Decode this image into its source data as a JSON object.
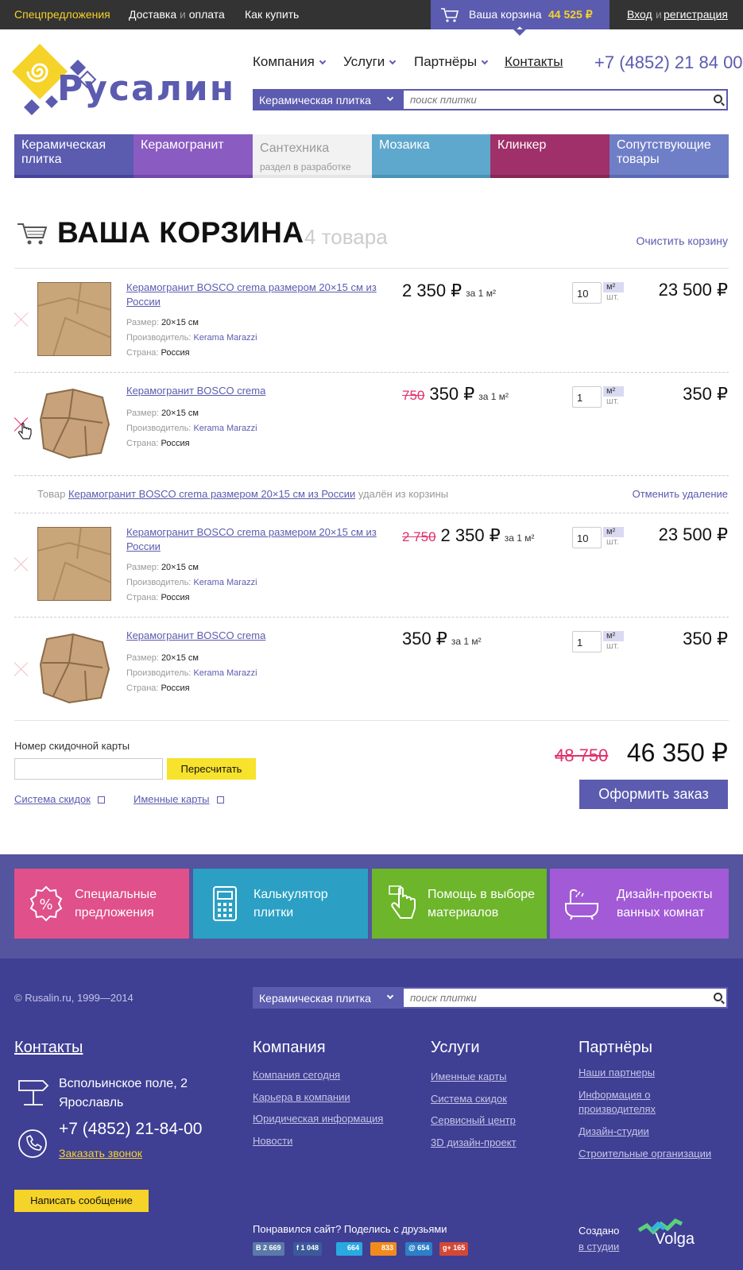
{
  "topbar": {
    "special": "Спецпредложения",
    "delivery_a": "Доставка",
    "delivery_and": "и",
    "delivery_b": "оплата",
    "how": "Как купить",
    "cart_label": "Ваша корзина",
    "cart_sum": "44 525 ₽",
    "login": "Вход",
    "login_and": "и",
    "register": "регистрация"
  },
  "header": {
    "logo_text": "Русалин",
    "nav": [
      "Компания",
      "Услуги",
      "Партнёры",
      "Контакты"
    ],
    "phone": "+7 (4852) 21 84 00",
    "search_category": "Керамическая плитка",
    "search_placeholder": "поиск плитки"
  },
  "categories": [
    {
      "label": "Керамическая плитка",
      "color": "#5b5bb0"
    },
    {
      "label": "Керамогранит",
      "color": "#8a5cc2"
    },
    {
      "label": "Сантехника",
      "sub": "раздел в разработке",
      "color": "#f2f2f2"
    },
    {
      "label": "Мозаика",
      "color": "#5fa8cd"
    },
    {
      "label": "Клинкер",
      "color": "#a0306a"
    },
    {
      "label": "Сопутствующие товары",
      "color": "#6f7fc7"
    }
  ],
  "cart": {
    "title": "ВАША КОРЗИНА",
    "count": "4 товара",
    "clear": "Очистить корзину",
    "size_label": "Размер:",
    "maker_label": "Производитель:",
    "country_label": "Страна:",
    "per_unit": "за 1 м²",
    "unit_a": "м²",
    "unit_b": "шт.",
    "items": [
      {
        "name": "Керамогранит BOSCO crema размером 20×15 см из России",
        "size": "20×15 см",
        "maker": "Kerama Marazzi",
        "country": "Россия",
        "old_price": "",
        "price": "2 350 ₽",
        "qty": "10",
        "total": "23 500 ₽"
      },
      {
        "name": "Керамогранит BOSCO crema",
        "size": "20×15 см",
        "maker": "Kerama Marazzi",
        "country": "Россия",
        "old_price": "750",
        "price": "350 ₽",
        "qty": "1",
        "total": "350 ₽"
      },
      {
        "name": "Керамогранит BOSCO crema размером 20×15 см из России",
        "size": "20×15 см",
        "maker": "Kerama Marazzi",
        "country": "Россия",
        "old_price": "2 750",
        "price": "2 350 ₽",
        "qty": "10",
        "total": "23 500 ₽"
      },
      {
        "name": "Керамогранит BOSCO crema",
        "size": "20×15 см",
        "maker": "Kerama Marazzi",
        "country": "Россия",
        "old_price": "",
        "price": "350 ₽",
        "qty": "1",
        "total": "350 ₽"
      }
    ],
    "removed_prefix": "Товар",
    "removed_name": "Керамогранит BOSCO crema размером 20×15 см из России",
    "removed_suffix": "удалён из корзины",
    "undo": "Отменить удаление"
  },
  "totals": {
    "card_label": "Номер скидочной карты",
    "recalc": "Пересчитать",
    "discount_system": "Система скидок",
    "named_cards": "Именные карты",
    "old_total": "48 750",
    "new_total": "46 350 ₽",
    "order": "Оформить заказ"
  },
  "promo": [
    {
      "label": "Специальные предложения",
      "icon": "percent-badge-icon",
      "color": "#e0508a"
    },
    {
      "label": "Калькулятор плитки",
      "icon": "calculator-icon",
      "color": "#2ba0c4"
    },
    {
      "label": "Помощь в выборе материалов",
      "icon": "hand-pointer-icon",
      "color": "#6db52a"
    },
    {
      "label": "Дизайн-проекты ванных комнат",
      "icon": "bathtub-icon",
      "color": "#a25ad6"
    }
  ],
  "footer": {
    "copyright": "© Rusalin.ru, 1999—2014",
    "search_category": "Керамическая плитка",
    "search_placeholder": "поиск плитки",
    "contacts_title": "Контакты",
    "address": [
      "Вспольинское поле, 2",
      "Ярославль"
    ],
    "phone": "+7 (4852) 21-84-00",
    "callback": "Заказать звонок",
    "message": "Написать сообщение",
    "company_title": "Компания",
    "company_links": [
      "Компания сегодня",
      "Карьера в компании",
      "Юридическая информация",
      "Новости"
    ],
    "services_title": "Услуги",
    "services_links": [
      "Именные карты",
      "Система скидок",
      "Сервисный центр",
      "3D дизайн-проект"
    ],
    "partners_title": "Партнёры",
    "partners_links": [
      "Наши партнеры",
      "Информация о производителях",
      "Дизайн-студии",
      "Строительные организации"
    ],
    "share": "Понравился сайт? Поделись с друзьями",
    "social": [
      {
        "label": "В 2 669",
        "color": "#5a7aa8"
      },
      {
        "label": "f 1 048",
        "color": "#3b5a9a"
      },
      {
        "label": "664",
        "color": "#2aa9e0"
      },
      {
        "label": "833",
        "color": "#f28a1e"
      },
      {
        "label": "@ 654",
        "color": "#2d7fc7"
      },
      {
        "label": "g+ 165",
        "color": "#d34836"
      }
    ],
    "made_in": "Создано",
    "studio": "в студии",
    "studio_name": "Volga"
  }
}
